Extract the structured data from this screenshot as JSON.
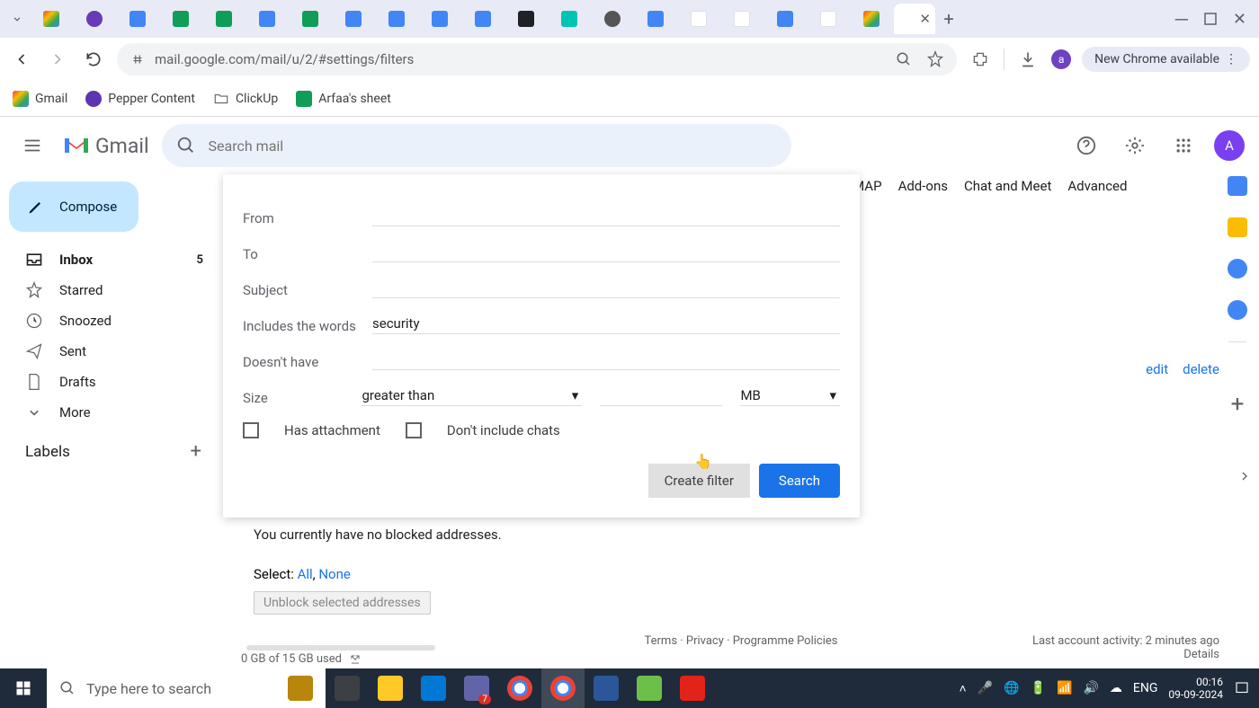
{
  "browser": {
    "url": "mail.google.com/mail/u/2/#settings/filters",
    "new_chrome": "New Chrome available",
    "avatar_letter": "a",
    "bookmarks": [
      {
        "label": "Gmail",
        "kind": "gmail"
      },
      {
        "label": "Pepper Content",
        "kind": "purple"
      },
      {
        "label": "ClickUp",
        "kind": "folder"
      },
      {
        "label": "Arfaa's sheet",
        "kind": "sheets"
      }
    ]
  },
  "gmail": {
    "brand": "Gmail",
    "search_placeholder": "Search mail",
    "avatar_letter": "A",
    "compose": "Compose",
    "nav": [
      {
        "icon": "inbox",
        "label": "Inbox",
        "count": "5",
        "active": true
      },
      {
        "icon": "star",
        "label": "Starred"
      },
      {
        "icon": "clock",
        "label": "Snoozed"
      },
      {
        "icon": "send",
        "label": "Sent"
      },
      {
        "icon": "file",
        "label": "Drafts"
      },
      {
        "icon": "chev",
        "label": "More"
      }
    ],
    "labels_header": "Labels"
  },
  "panel": {
    "from": "From",
    "to": "To",
    "subject": "Subject",
    "includes": "Includes the words",
    "includes_value": "security",
    "doesnt": "Doesn't have",
    "size": "Size",
    "size_op": "greater than",
    "size_unit": "MB",
    "has_attach": "Has attachment",
    "no_chats": "Don't include chats",
    "create_filter": "Create filter",
    "search": "Search"
  },
  "settings": {
    "visible_tabs": [
      "IMAP",
      "Add-ons",
      "Chat and Meet",
      "Advanced"
    ],
    "edit": "edit",
    "delete": "delete",
    "blocked_msg": "You currently have no blocked addresses.",
    "select_label": "Select: ",
    "select_all": "All",
    "select_none": "None",
    "unblock": "Unblock selected addresses",
    "storage": "0 GB of 15 GB used",
    "footer_links": "Terms · Privacy · Programme Policies",
    "activity": "Last account activity: 2 minutes ago",
    "details": "Details"
  },
  "taskbar": {
    "search": "Type here to search",
    "lang": "ENG",
    "time": "00:16",
    "date": "09-09-2024",
    "teams_badge": "7"
  }
}
